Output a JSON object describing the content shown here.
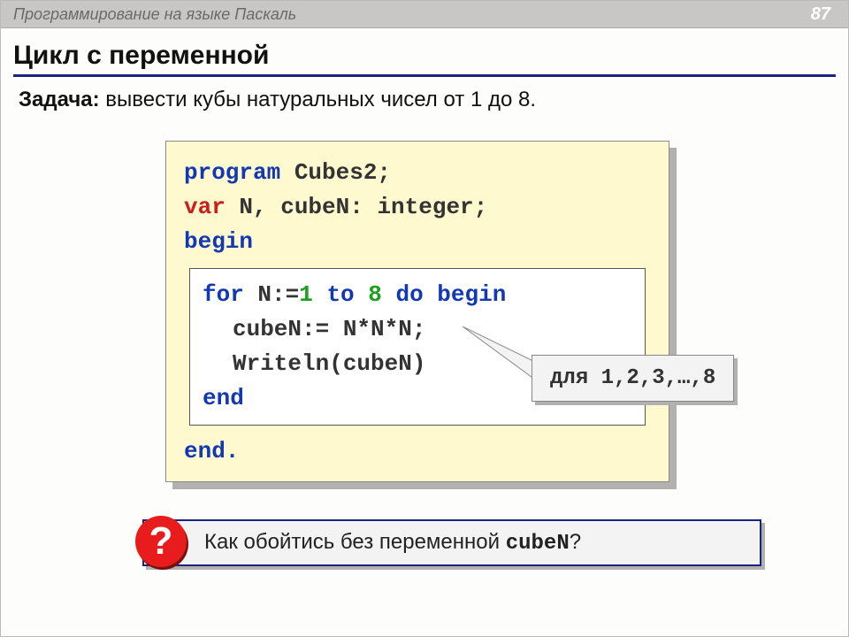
{
  "header": {
    "title": "Программирование на языке Паскаль",
    "page": "87"
  },
  "slide": {
    "title": "Цикл с переменной",
    "task_label": "Задача:",
    "task_text": " вывести кубы натуральных чисел от 1 до 8."
  },
  "code": {
    "l1a": "program",
    "l1b": " Cubes2;",
    "l2a": "var",
    "l2b": " N, cubeN: integer;",
    "l3": "begin",
    "inner": {
      "l1a": "for",
      "l1b": " N:=",
      "l1c": "1",
      "l1d": " to ",
      "l1e": "8",
      "l1f": " do begin",
      "l2": "cubeN:= N*N*N;",
      "l3": "Writeln(cubeN)",
      "l4": "end"
    },
    "l5": "end."
  },
  "callout": {
    "text": "для 1,2,3,…,8"
  },
  "question": {
    "badge": "?",
    "text_before": " Как обойтись без переменной ",
    "text_mono": "cubeN",
    "text_after": "?"
  }
}
